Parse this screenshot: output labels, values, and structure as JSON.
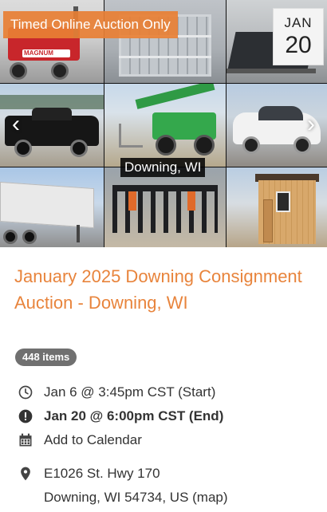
{
  "gallery": {
    "badge": "Timed Online Auction Only",
    "date": {
      "month": "JAN",
      "day": "20"
    },
    "location_tag": "Downing, WI",
    "prev_icon": "chevron-left-icon",
    "next_icon": "chevron-right-icon",
    "tiles": [
      {
        "text": "MAGNUM"
      },
      {
        "text": ""
      }
    ]
  },
  "auction": {
    "title": "January 2025 Downing Consignment Auction - Downing, WI",
    "items_count": "448 items",
    "start": "Jan 6 @ 3:45pm CST (Start)",
    "end": "Jan 20 @ 6:00pm CST (End)",
    "calendar": "Add to Calendar",
    "address_line1": "E1026 St. Hwy 170",
    "address_line2": "Downing, WI 54734, US (map)"
  },
  "colors": {
    "accent": "#e8843c",
    "pill": "#707070",
    "text": "#333333"
  },
  "icons": {
    "start": "clock-icon",
    "end": "alert-circle-icon",
    "calendar": "calendar-icon",
    "location": "map-pin-icon"
  }
}
